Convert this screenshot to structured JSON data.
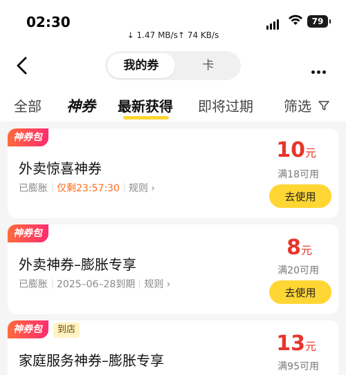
{
  "status_bar": {
    "time": "02:30",
    "speed": "↓ 1.47 MB/s↑ 74 KB/s",
    "battery": "79"
  },
  "nav": {
    "segment_selected": "我的券",
    "segment_other": "卡"
  },
  "tabs": [
    {
      "label": "全部"
    },
    {
      "label": "神券"
    },
    {
      "label": "最新获得",
      "active": true
    },
    {
      "label": "即将过期"
    },
    {
      "label": "筛选"
    }
  ],
  "coupons": [
    {
      "badge": "神券包",
      "title": "外卖惊喜神券",
      "status": "已膨胀",
      "time_info": "仅剩23:57:30",
      "rule": "规则 ›",
      "amount": "10",
      "unit": "元",
      "condition": "满18可用",
      "button": "去使用"
    },
    {
      "badge": "神券包",
      "title": "外卖神券–膨胀专享",
      "status": "已膨胀",
      "time_info": "2025–06–28到期",
      "rule": "规则 ›",
      "amount": "8",
      "unit": "元",
      "condition": "满20可用",
      "button": "去使用"
    },
    {
      "badge": "神券包",
      "extra_tag": "到店",
      "title": "家庭服务神券–膨胀专享",
      "amount": "13",
      "unit": "元",
      "condition": "满95可用"
    }
  ],
  "colors": {
    "accent_yellow": "#ffd633",
    "price_red": "#e8352b",
    "remain_orange": "#ff6a1a"
  },
  "icons": [
    "back-arrow-icon",
    "more-icon",
    "funnel-icon",
    "wifi-icon",
    "signal-icon",
    "battery-icon"
  ]
}
